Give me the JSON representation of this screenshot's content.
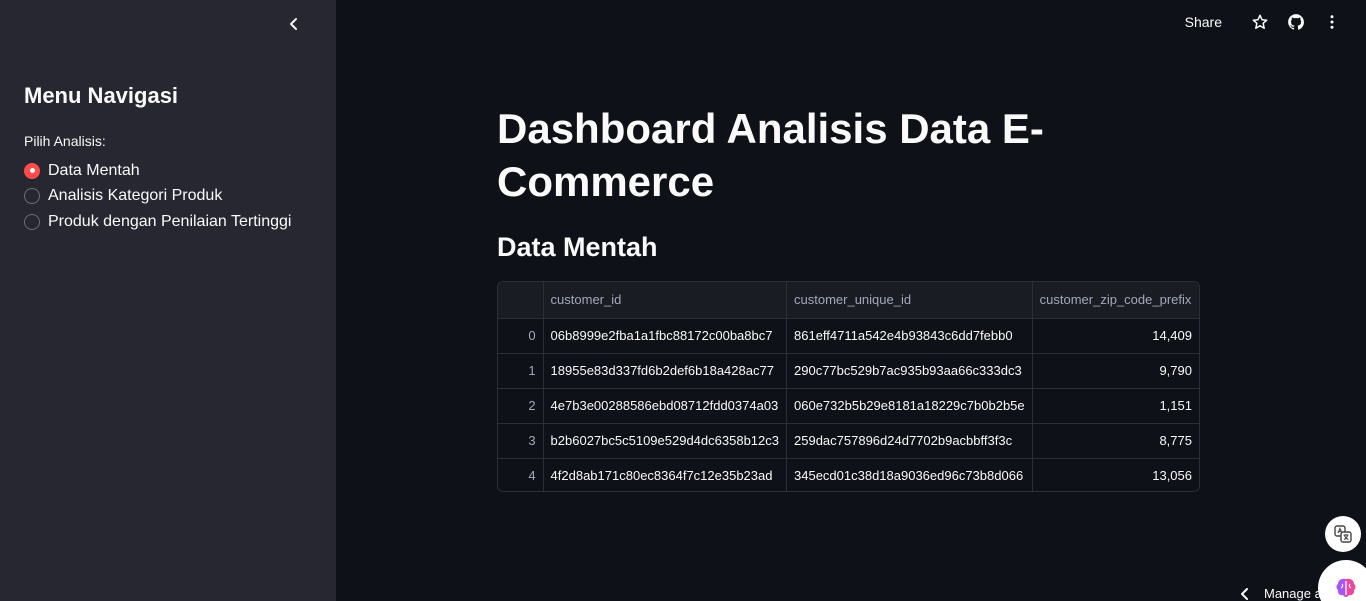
{
  "sidebar": {
    "title": "Menu Navigasi",
    "radio_label": "Pilih Analisis:",
    "options": [
      {
        "label": "Data Mentah",
        "selected": true
      },
      {
        "label": "Analisis Kategori Produk",
        "selected": false
      },
      {
        "label": "Produk dengan Penilaian Tertinggi",
        "selected": false
      }
    ]
  },
  "toolbar": {
    "share_label": "Share"
  },
  "main": {
    "title": "Dashboard Analisis Data E-Commerce",
    "section_title": "Data Mentah",
    "table": {
      "columns": [
        "",
        "customer_id",
        "customer_unique_id",
        "customer_zip_code_prefix"
      ],
      "rows": [
        [
          "0",
          "06b8999e2fba1a1fbc88172c00ba8bc7",
          "861eff4711a542e4b93843c6dd7febb0",
          "14,409"
        ],
        [
          "1",
          "18955e83d337fd6b2def6b18a428ac77",
          "290c77bc529b7ac935b93aa66c333dc3",
          "9,790"
        ],
        [
          "2",
          "4e7b3e00288586ebd08712fdd0374a03",
          "060e732b5b29e8181a18229c7b0b2b5e",
          "1,151"
        ],
        [
          "3",
          "b2b6027bc5c5109e529d4dc6358b12c3",
          "259dac757896d24d7702b9acbbff3f3c",
          "8,775"
        ],
        [
          "4",
          "4f2d8ab171c80ec8364f7c12e35b23ad",
          "345ecd01c38d18a9036ed96c73b8d066",
          "13,056"
        ]
      ]
    }
  },
  "footer": {
    "manage_label": "Manage a"
  },
  "colors": {
    "accent": "#ff4b4b",
    "sidebar_bg": "#262730",
    "main_bg": "#0e1117"
  }
}
